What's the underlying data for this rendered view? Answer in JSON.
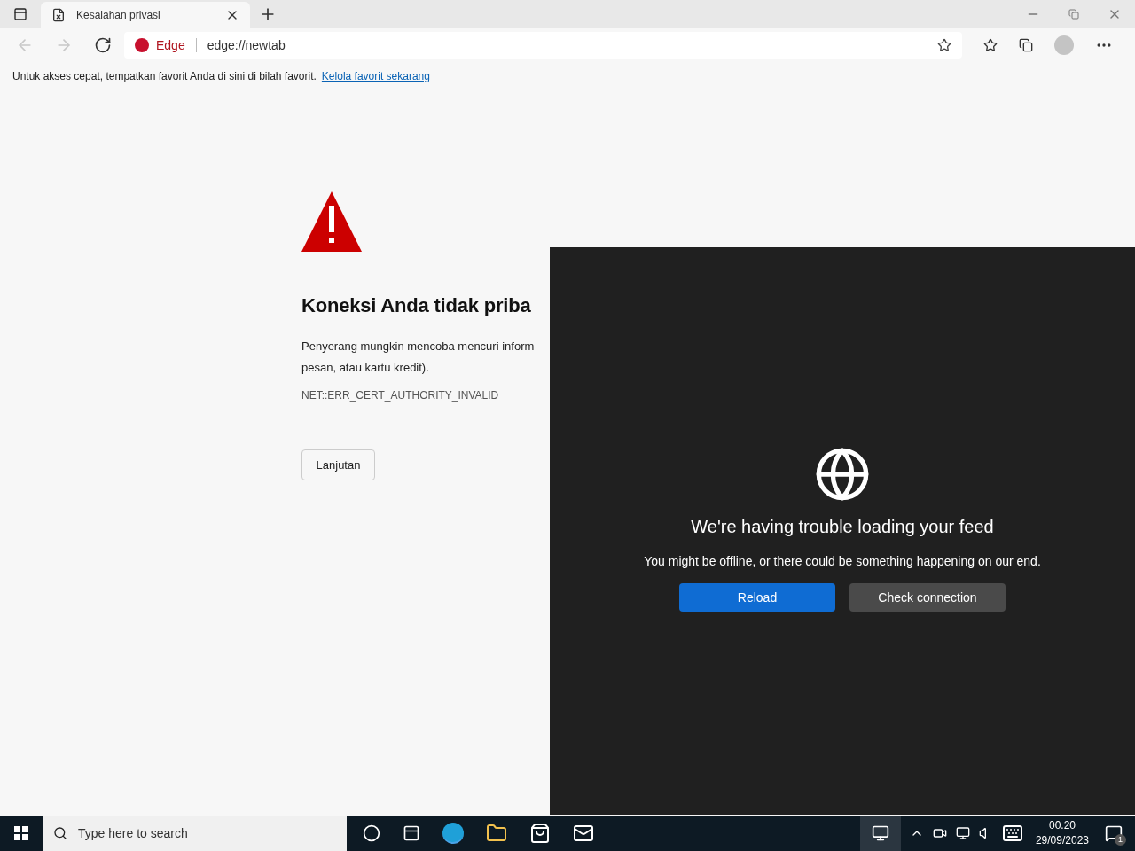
{
  "tabs": [
    {
      "title": "Kesalahan privasi",
      "selected": true
    }
  ],
  "address_bar": {
    "site_label": "Edge",
    "url": "edge://newtab"
  },
  "favorites_bar": {
    "message": "Untuk akses cepat, tempatkan favorit Anda di sini di bilah favorit.",
    "link": "Kelola favorit sekarang"
  },
  "error_page": {
    "heading": "Koneksi Anda tidak priba",
    "body_lines": [
      "Penyerang mungkin mencoba mencuri inform",
      "pesan, atau kartu kredit)."
    ],
    "code": "NET::ERR_CERT_AUTHORITY_INVALID",
    "button": "Lanjutan"
  },
  "feed_panel": {
    "title": "We're having trouble loading your feed",
    "message": "You might be offline, or there could be something happening on our end.",
    "buttons": [
      {
        "label": "Reload",
        "kind": "primary"
      },
      {
        "label": "Check connection",
        "kind": "secondary"
      }
    ]
  },
  "taskbar": {
    "search_placeholder": "Type here to search",
    "time": "00.20",
    "date": "29/09/2023",
    "notification_count": "1"
  }
}
